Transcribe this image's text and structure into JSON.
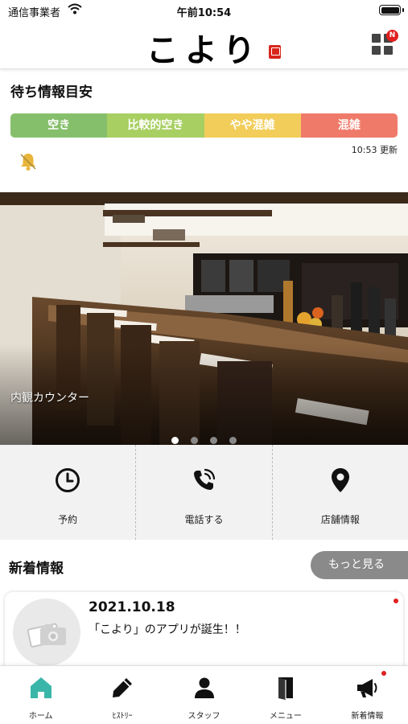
{
  "status_bar": {
    "carrier": "通信事業者",
    "time": "午前10:54"
  },
  "header": {
    "logo": "こより"
  },
  "wait_info": {
    "title": "待ち情報目安",
    "levels": [
      {
        "label": "空き",
        "color": "#86bf6b"
      },
      {
        "label": "比較的空き",
        "color": "#a8cf62"
      },
      {
        "label": "やや混雑",
        "color": "#f2cd5a"
      },
      {
        "label": "混雑",
        "color": "#ef7a6a"
      }
    ],
    "updated": "10:53 更新"
  },
  "photo": {
    "caption": "内観カウンター",
    "slide_count": 4,
    "active_slide": 1
  },
  "actions": [
    {
      "label": "予約",
      "icon": "clock-icon"
    },
    {
      "label": "電話する",
      "icon": "phone-icon"
    },
    {
      "label": "店舗情報",
      "icon": "map-pin-icon"
    }
  ],
  "news": {
    "title": "新着情報",
    "more_label": "もっと見る",
    "items": [
      {
        "date": "2021.10.18",
        "text": "「こより」のアプリが誕生！！"
      }
    ]
  },
  "tabbar": [
    {
      "label": "ホーム",
      "icon": "home-icon",
      "active": true
    },
    {
      "label": "ﾋｽﾄﾘｰ",
      "icon": "pencil-icon"
    },
    {
      "label": "スタッフ",
      "icon": "person-icon"
    },
    {
      "label": "メニュー",
      "icon": "book-icon"
    },
    {
      "label": "新着情報",
      "icon": "megaphone-icon"
    }
  ],
  "colors": {
    "accent": "#3ab6a9",
    "badge": "#e02020"
  }
}
